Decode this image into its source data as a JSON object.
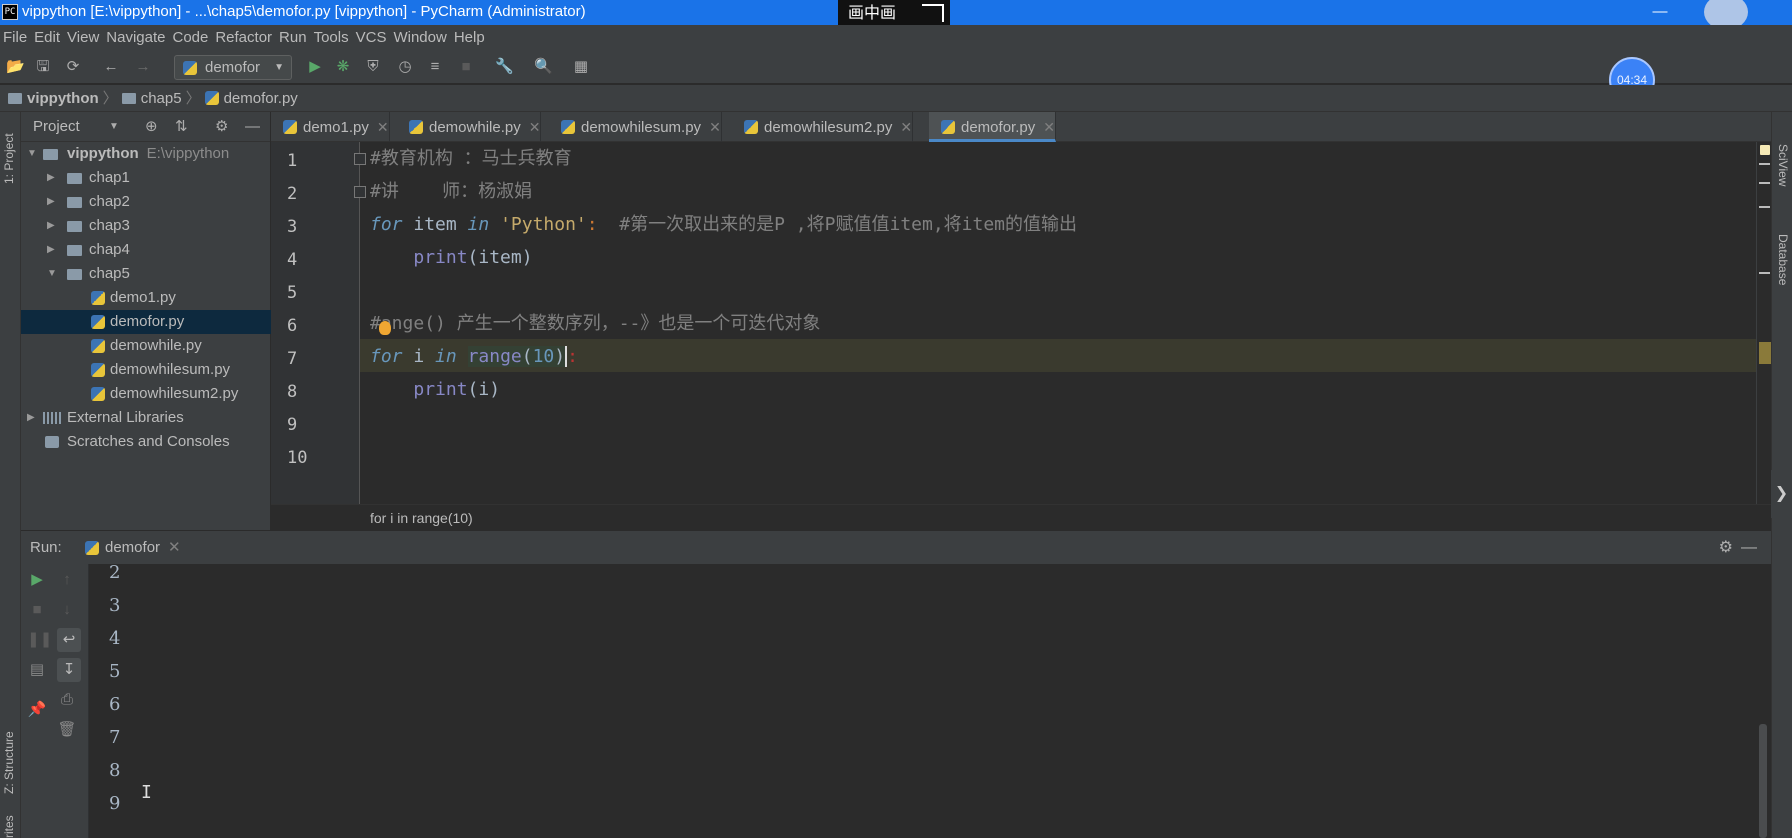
{
  "window": {
    "icon_text": "PC",
    "title": "vippython [E:\\vippython] - ...\\chap5\\demofor.py [vippython] - PyCharm (Administrator)",
    "pip_label": "画中画",
    "minimize": "—"
  },
  "menu": [
    "File",
    "Edit",
    "View",
    "Navigate",
    "Code",
    "Refactor",
    "Run",
    "Tools",
    "VCS",
    "Window",
    "Help"
  ],
  "toolbar": {
    "run_config": "demofor",
    "timer": "04:34"
  },
  "breadcrumb": {
    "project": "vippython",
    "folder": "chap5",
    "file": "demofor.py"
  },
  "left_strip": {
    "project_label": "1: Project",
    "structure_label": "Z: Structure",
    "favorites_label": "rites"
  },
  "right_strip": {
    "sciview_label": "SciView",
    "database_label": "Database"
  },
  "project_panel": {
    "title": "Project",
    "root": {
      "name": "vippython",
      "path": "E:\\vippython"
    },
    "folders": [
      "chap1",
      "chap2",
      "chap3",
      "chap4",
      "chap5"
    ],
    "files": [
      "demo1.py",
      "demofor.py",
      "demowhile.py",
      "demowhilesum.py",
      "demowhilesum2.py"
    ],
    "external_libraries": "External Libraries",
    "scratches": "Scratches and Consoles"
  },
  "tabs": [
    {
      "label": "demo1.py"
    },
    {
      "label": "demowhile.py"
    },
    {
      "label": "demowhilesum.py"
    },
    {
      "label": "demowhilesum2.py"
    },
    {
      "label": "demofor.py",
      "active": true
    }
  ],
  "editor": {
    "line_numbers": [
      "1",
      "2",
      "3",
      "4",
      "5",
      "6",
      "7",
      "8",
      "9",
      "10"
    ],
    "lines": {
      "l1_comment": "#教育机构 ：马士兵教育",
      "l2_comment": "#讲    师：杨淑娟",
      "l3_for": "for",
      "l3_var": " item ",
      "l3_in": "in",
      "l3_str": " 'Python'",
      "l3_colon": ":",
      "l3_comment": "  #第一次取出来的是P ,将P赋值值item,将item的值输出",
      "l4_indent": "    ",
      "l4_print": "print",
      "l4_args": "(item)",
      "l6_hash": "#",
      "l6_comment": "ange() 产生一个整数序列，--》也是一个可迭代对象",
      "l7_for": "for",
      "l7_var": " i ",
      "l7_in": "in",
      "l7_range": "range",
      "l7_open": "(",
      "l7_num": "10",
      "l7_close": ")",
      "l7_colon": ":",
      "l8_indent": "    ",
      "l8_print": "print",
      "l8_args": "(i)"
    },
    "context_crumb": "for i in range(10)"
  },
  "run_panel": {
    "label": "Run:",
    "tab": "demofor",
    "output": [
      "2",
      "3",
      "4",
      "5",
      "6",
      "7",
      "8",
      "9"
    ]
  },
  "colors": {
    "title_bar": "#1a73e8",
    "editor_bg": "#2b2b2b",
    "panel_bg": "#3c3f41",
    "selection": "#0d293e",
    "active_tab_underline": "#4a88c7"
  }
}
